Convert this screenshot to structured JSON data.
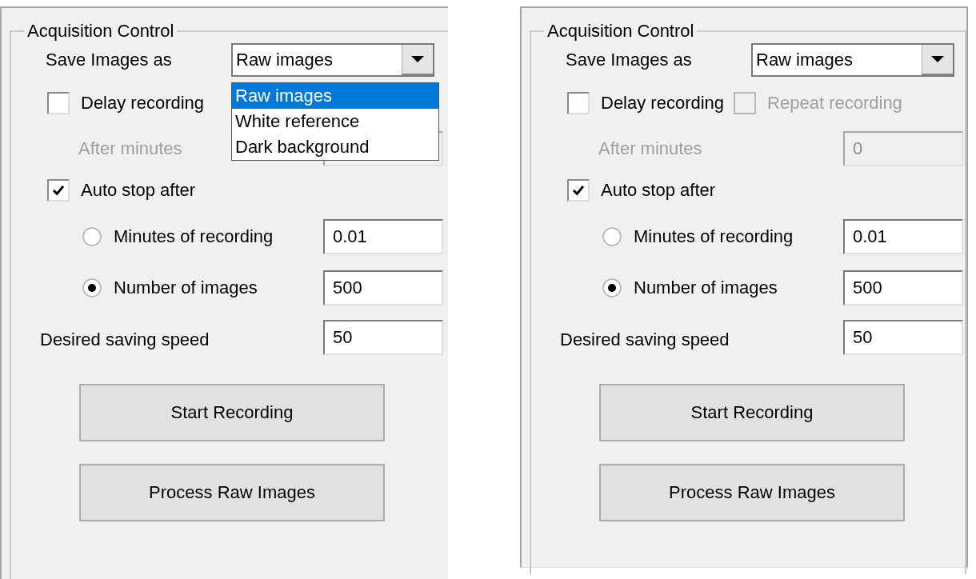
{
  "panels": [
    {
      "group_title": "Acquisition Control",
      "save_as": {
        "label": "Save Images as",
        "value": "Raw images",
        "options": [
          {
            "label": "Raw images",
            "selected": true
          },
          {
            "label": "White reference",
            "selected": false
          },
          {
            "label": "Dark background",
            "selected": false
          }
        ]
      },
      "delay": {
        "label": "Delay recording",
        "checked": false
      },
      "after_minutes": {
        "label": "After minutes",
        "disabled": true
      },
      "auto_stop": {
        "label": "Auto stop after",
        "checked": true
      },
      "stop_options": [
        {
          "label": "Minutes of recording",
          "selected": false,
          "value": "0.01"
        },
        {
          "label": "Number of images",
          "selected": true,
          "value": "500"
        }
      ],
      "speed": {
        "label": "Desired saving speed",
        "value": "50"
      },
      "buttons": [
        "Start Recording",
        "Process Raw Images"
      ]
    },
    {
      "group_title": "Acquisition Control",
      "save_as": {
        "label": "Save Images as",
        "value": "Raw images"
      },
      "delay": {
        "label": "Delay recording",
        "checked": false
      },
      "repeat": {
        "label": "Repeat recording",
        "checked": false,
        "disabled": true
      },
      "after_minutes": {
        "label": "After minutes",
        "disabled": true,
        "value": "0"
      },
      "auto_stop": {
        "label": "Auto stop after",
        "checked": true
      },
      "stop_options": [
        {
          "label": "Minutes of recording",
          "selected": false,
          "value": "0.01"
        },
        {
          "label": "Number of images",
          "selected": true,
          "value": "500"
        }
      ],
      "speed": {
        "label": "Desired saving speed",
        "value": "50"
      },
      "buttons": [
        "Start Recording",
        "Process Raw Images"
      ]
    }
  ]
}
